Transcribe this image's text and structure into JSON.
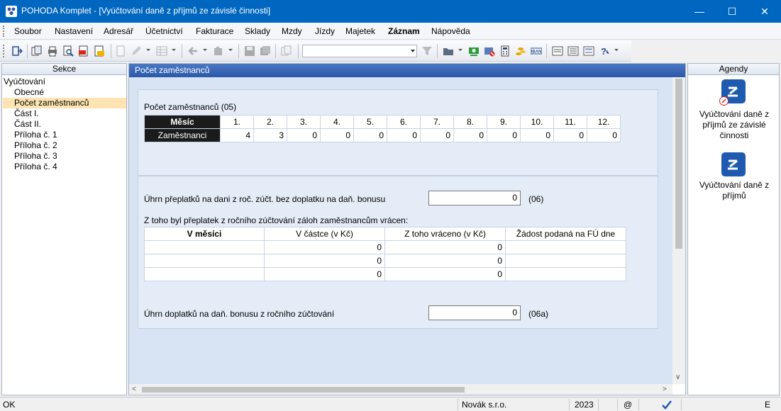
{
  "window": {
    "title": "POHODA Komplet - [Vyúčtování daně z příjmů ze závislé činnosti]",
    "minimize": "—",
    "maximize": "☐",
    "close": "✕"
  },
  "menu": [
    "Soubor",
    "Nastavení",
    "Adresář",
    "Účetnictví",
    "Fakturace",
    "Sklady",
    "Mzdy",
    "Jízdy",
    "Majetek",
    "Záznam",
    "Nápověda"
  ],
  "sekce": {
    "header": "Sekce",
    "root": "Vyúčtování",
    "items": [
      "Obecné",
      "Počet zaměstnanců",
      "Část I.",
      "Část II.",
      "Příloha č. 1",
      "Příloha č. 2",
      "Příloha č. 3",
      "Příloha č. 4"
    ],
    "selected": "Počet zaměstnanců"
  },
  "main": {
    "header": "Počet zaměstnanců",
    "count_section_label": "Počet zaměstnanců (05)",
    "month_header": "Měsíc",
    "months": [
      "1.",
      "2.",
      "3.",
      "4.",
      "5.",
      "6.",
      "7.",
      "8.",
      "9.",
      "10.",
      "11.",
      "12."
    ],
    "employees_row_label": "Zaměstnanci",
    "employees": [
      "4",
      "3",
      "0",
      "0",
      "0",
      "0",
      "0",
      "0",
      "0",
      "0",
      "0",
      "0"
    ],
    "overpay_label": "Úhrn přeplatků na dani z roč. zúčt. bez doplatku na daň. bonusu",
    "overpay_value": "0",
    "overpay_code": "(06)",
    "refund_label": "Z toho byl přeplatek z ročního zúčtování záloh zaměstnancům vrácen:",
    "refund_columns": [
      "V měsíci",
      "V částce (v Kč)",
      "Z toho vráceno (v Kč)",
      "Žádost podaná na FÚ dne"
    ],
    "refund_rows": [
      {
        "month": "",
        "amount": "0",
        "returned": "0",
        "request": ""
      },
      {
        "month": "",
        "amount": "0",
        "returned": "0",
        "request": ""
      },
      {
        "month": "",
        "amount": "0",
        "returned": "0",
        "request": ""
      }
    ],
    "bonus_label": "Úhrn doplatků na daň. bonusu z ročního zúčtování",
    "bonus_value": "0",
    "bonus_code": "(06a)"
  },
  "agendy": {
    "header": "Agendy",
    "items": [
      "Vyúčtování daně z příjmů ze závislé činnosti",
      "Vyúčtování daně z příjmů"
    ]
  },
  "status": {
    "left": "OK",
    "company": "Novák  s.r.o.",
    "year": "2023",
    "at": "@",
    "end": "E"
  },
  "colors": {
    "title_bar": "#0067c0",
    "main_header": "#2a58a8",
    "selection": "#fde4b2",
    "agenda_icon": "#1e5bb0"
  }
}
